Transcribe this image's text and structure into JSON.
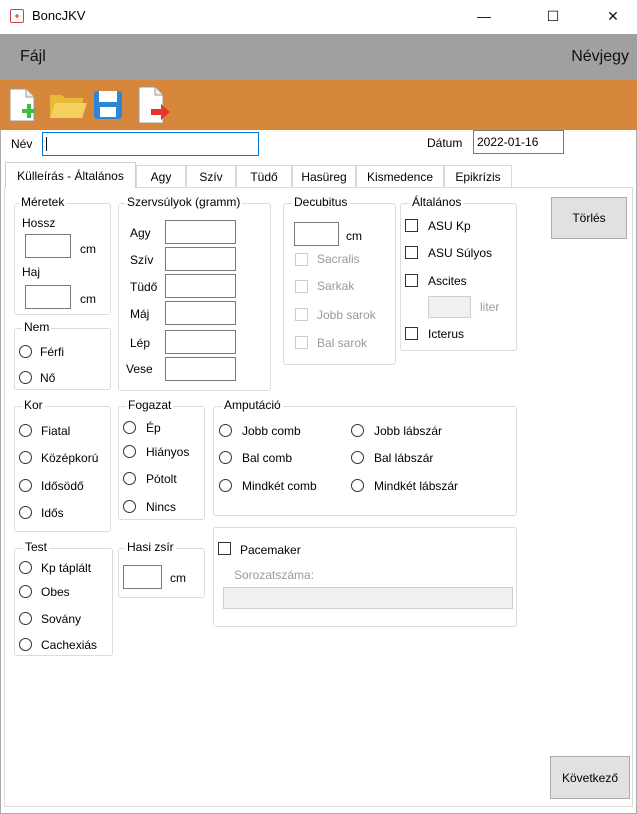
{
  "window": {
    "title": "BoncJKV",
    "minimize": "—",
    "maximize": "☐",
    "close": "✕"
  },
  "menu": {
    "file": "Fájl",
    "card": "Névjegy"
  },
  "toolbar": {
    "icons": [
      "new-document-icon",
      "open-folder-icon",
      "save-icon",
      "export-icon"
    ]
  },
  "form": {
    "name_label": "Név",
    "name_value": "",
    "date_label": "Dátum",
    "date_value": "2022-01-16"
  },
  "tabs": [
    "Külleírás - Általános",
    "Agy",
    "Szív",
    "Tüdő",
    "Hasüreg",
    "Kismedence",
    "Epikrízis"
  ],
  "measurements": {
    "title": "Méretek",
    "height_label": "Hossz",
    "hair_label": "Haj",
    "unit": "cm"
  },
  "organs": {
    "title": "Szervsúlyok (gramm)",
    "items": [
      "Agy",
      "Szív",
      "Tüdő",
      "Máj",
      "Lép",
      "Vese"
    ]
  },
  "decubitus": {
    "title": "Decubitus",
    "unit": "cm",
    "items": [
      "Sacralis",
      "Sarkak",
      "Jobb sarok",
      "Bal sarok"
    ]
  },
  "general": {
    "title": "Általános",
    "asu_kp": "ASU Kp",
    "asu_sulyos": "ASU Súlyos",
    "ascites": "Ascites",
    "liter": "liter",
    "icterus": "Icterus"
  },
  "clear_button": "Törlés",
  "sex": {
    "title": "Nem",
    "options": [
      "Férfi",
      "Nő"
    ]
  },
  "age": {
    "title": "Kor",
    "options": [
      "Fiatal",
      "Középkorú",
      "Idősödő",
      "Idős"
    ]
  },
  "teeth": {
    "title": "Fogazat",
    "options": [
      "Ép",
      "Hiányos",
      "Pótolt",
      "Nincs"
    ]
  },
  "amputation": {
    "title": "Amputáció",
    "options": [
      "Jobb comb",
      "Bal comb",
      "Mindkét comb",
      "Jobb lábszár",
      "Bal lábszár",
      "Mindkét lábszár"
    ]
  },
  "body": {
    "title": "Test",
    "options": [
      "Kp táplált",
      "Obes",
      "Sovány",
      "Cachexiás"
    ]
  },
  "belly_fat": {
    "title": "Hasi zsír",
    "unit": "cm"
  },
  "pacemaker": {
    "label": "Pacemaker",
    "serial_label": "Sorozatszáma:"
  },
  "next_button": "Következő"
}
